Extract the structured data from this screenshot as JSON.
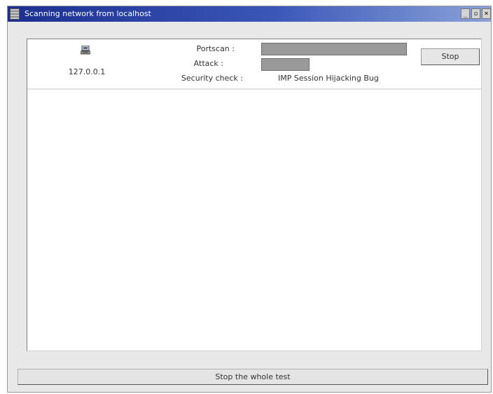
{
  "window": {
    "title": "Scanning network from localhost",
    "controls": {
      "minimize": "_",
      "maximize": "▫",
      "close": "×"
    }
  },
  "host": {
    "icon": "computer-icon",
    "ip": "127.0.0.1",
    "portscan": {
      "label": "Portscan :",
      "progress": 1.0
    },
    "attack": {
      "label": "Attack :",
      "progress": 0.33
    },
    "security_check": {
      "label": "Security check :",
      "value": "IMP Session Hijacking Bug"
    },
    "stop_label": "Stop"
  },
  "footer": {
    "stop_all_label": "Stop the whole test"
  },
  "colors": {
    "title_start": "#1b2f90",
    "title_end": "#8aa2d8",
    "progress_fill": "#9a9a9a",
    "window_bg": "#e8e8e8"
  }
}
